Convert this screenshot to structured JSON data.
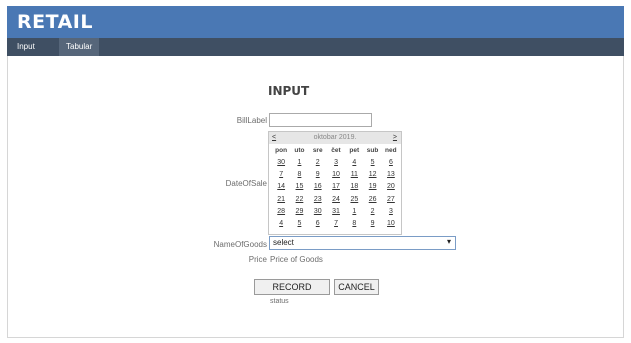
{
  "header": {
    "brand": "RETAIL"
  },
  "nav": {
    "items": [
      {
        "label": "Input"
      },
      {
        "label": "Tabular"
      }
    ]
  },
  "form": {
    "title": "INPUT",
    "bill_label": "BillLabel",
    "bill_value": "",
    "date_label": "DateOfSale",
    "goods_label": "NameOfGoods",
    "goods_selected": "select",
    "price_label": "Price",
    "price_value": "Price of Goods",
    "record_button": "RECORD",
    "cancel_button": "CANCEL",
    "status": "status"
  },
  "calendar": {
    "prev": "<",
    "next": ">",
    "month": "oktobar 2019.",
    "dows": [
      "pon",
      "uto",
      "sre",
      "čet",
      "pet",
      "sub",
      "ned"
    ],
    "weeks": [
      [
        "30",
        "1",
        "2",
        "3",
        "4",
        "5",
        "6"
      ],
      [
        "7",
        "8",
        "9",
        "10",
        "11",
        "12",
        "13"
      ],
      [
        "14",
        "15",
        "16",
        "17",
        "18",
        "19",
        "20"
      ],
      [
        "21",
        "22",
        "23",
        "24",
        "25",
        "26",
        "27"
      ],
      [
        "28",
        "29",
        "30",
        "31",
        "1",
        "2",
        "3"
      ],
      [
        "4",
        "5",
        "6",
        "7",
        "8",
        "9",
        "10"
      ]
    ]
  }
}
